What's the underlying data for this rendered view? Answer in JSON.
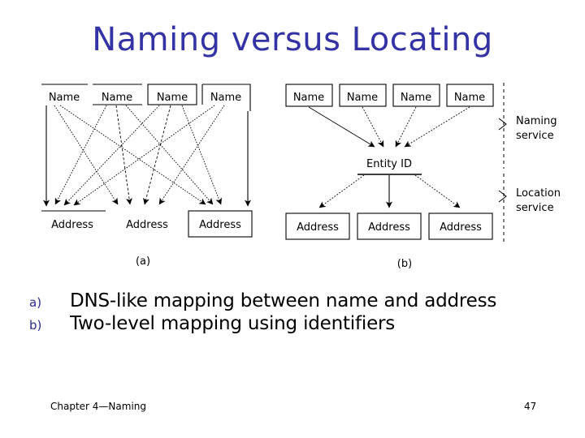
{
  "slide": {
    "title": "Naming versus Locating",
    "page_number": "47",
    "footer": "Chapter 4—Naming",
    "title_color": "#3333a6",
    "bullet_marker_color": "#2a2a8c",
    "text_color": "#000000"
  },
  "bullets": [
    {
      "marker": "a)",
      "text": "DNS-like mapping between name and address"
    },
    {
      "marker": "b)",
      "text": "Two-level mapping using identifiers"
    }
  ],
  "figure": {
    "diagram_a": {
      "caption": "(a)",
      "name_boxes": [
        {
          "label": "Name"
        },
        {
          "label": "Name"
        },
        {
          "label": "Name"
        },
        {
          "label": "Name"
        }
      ],
      "address_boxes": [
        {
          "label": "Address"
        },
        {
          "label": "Address"
        },
        {
          "label": "Address"
        }
      ],
      "description": "Each Name maps directly to three Addresses; twelve crossing arrows total"
    },
    "diagram_b": {
      "caption": "(b)",
      "name_boxes": [
        {
          "label": "Name"
        },
        {
          "label": "Name"
        },
        {
          "label": "Name"
        },
        {
          "label": "Name"
        }
      ],
      "entity_label": "Entity ID",
      "address_boxes": [
        {
          "label": "Address"
        },
        {
          "label": "Address"
        },
        {
          "label": "Address"
        }
      ],
      "service_labels": [
        {
          "line1": "Naming",
          "line2": "service"
        },
        {
          "line1": "Location",
          "line2": "service"
        }
      ],
      "description": "Four Names converge on one Entity ID which resolves to three Addresses"
    }
  }
}
